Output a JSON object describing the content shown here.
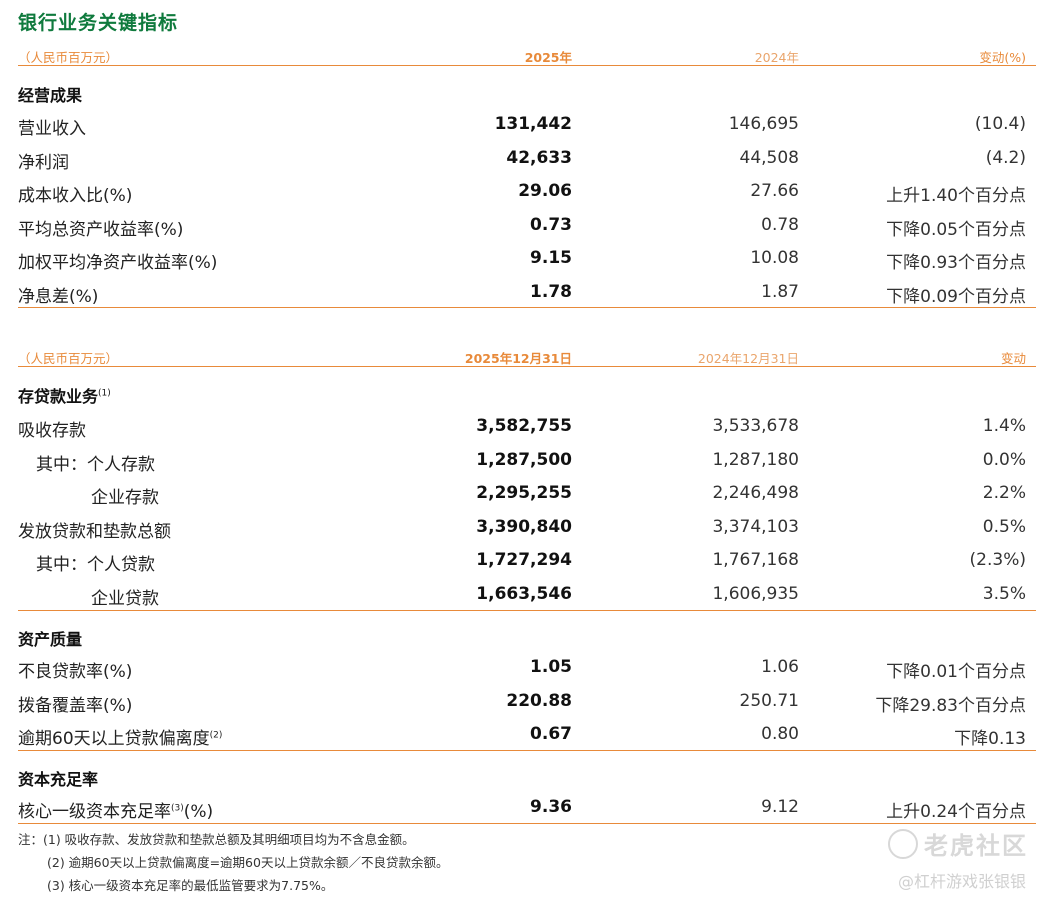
{
  "title": "银行业务关键指标",
  "header1": {
    "unit": "（人民币百万元）",
    "col1": "2025年",
    "col2": "2024年",
    "col3": "变动(%)"
  },
  "section_operating": "经营成果",
  "operating_rows": [
    {
      "label": "营业收入",
      "v2025": "131,442",
      "v2024": "146,695",
      "change": "(10.4)"
    },
    {
      "label": "净利润",
      "v2025": "42,633",
      "v2024": "44,508",
      "change": "(4.2)"
    },
    {
      "label": "成本收入比(%)",
      "v2025": "29.06",
      "v2024": "27.66",
      "change": "上升1.40个百分点"
    },
    {
      "label": "平均总资产收益率(%)",
      "v2025": "0.73",
      "v2024": "0.78",
      "change": "下降0.05个百分点"
    },
    {
      "label": "加权平均净资产收益率(%)",
      "v2025": "9.15",
      "v2024": "10.08",
      "change": "下降0.93个百分点"
    },
    {
      "label": "净息差(%)",
      "v2025": "1.78",
      "v2024": "1.87",
      "change": "下降0.09个百分点"
    }
  ],
  "header2": {
    "unit": "（人民币百万元）",
    "col1": "2025年12月31日",
    "col2": "2024年12月31日",
    "col3": "变动"
  },
  "section_deposits": "存贷款业务",
  "section_deposits_note": "(1)",
  "deposit_rows": [
    {
      "label": "吸收存款",
      "v2025": "3,582,755",
      "v2024": "3,533,678",
      "change": "1.4%"
    },
    {
      "label": "其中：个人存款",
      "v2025": "1,287,500",
      "v2024": "1,287,180",
      "change": "0.0%"
    },
    {
      "label": "企业存款",
      "v2025": "2,295,255",
      "v2024": "2,246,498",
      "change": "2.2%"
    },
    {
      "label": "发放贷款和垫款总额",
      "v2025": "3,390,840",
      "v2024": "3,374,103",
      "change": "0.5%"
    },
    {
      "label": "其中：个人贷款",
      "v2025": "1,727,294",
      "v2024": "1,767,168",
      "change": "(2.3%)"
    },
    {
      "label": "企业贷款",
      "v2025": "1,663,546",
      "v2024": "1,606,935",
      "change": "3.5%"
    }
  ],
  "section_quality": "资产质量",
  "quality_rows": [
    {
      "label": "不良贷款率(%)",
      "v2025": "1.05",
      "v2024": "1.06",
      "change": "下降0.01个百分点"
    },
    {
      "label": "拨备覆盖率(%)",
      "v2025": "220.88",
      "v2024": "250.71",
      "change": "下降29.83个百分点"
    },
    {
      "label": "逾期60天以上贷款偏离度",
      "note": "(2)",
      "v2025": "0.67",
      "v2024": "0.80",
      "change": "下降0.13"
    }
  ],
  "section_capital": "资本充足率",
  "capital_rows": [
    {
      "label": "核心一级资本充足率",
      "note": "(3)",
      "label_suffix": "(%)",
      "v2025": "9.36",
      "v2024": "9.12",
      "change": "上升0.24个百分点"
    }
  ],
  "notes": [
    "注：(1)  吸收存款、发放贷款和垫款总额及其明细项目均为不含息金额。",
    "(2)  逾期60天以上贷款偏离度=逾期60天以上贷款余额／不良贷款余额。",
    "(3)  核心一级资本充足率的最低监管要求为7.75%。"
  ],
  "watermark": {
    "brand": "老虎社区",
    "user": "@杠杆游戏张银银"
  },
  "colors": {
    "title_green": "#0f7a3d",
    "accent_orange": "#e88a3a"
  }
}
